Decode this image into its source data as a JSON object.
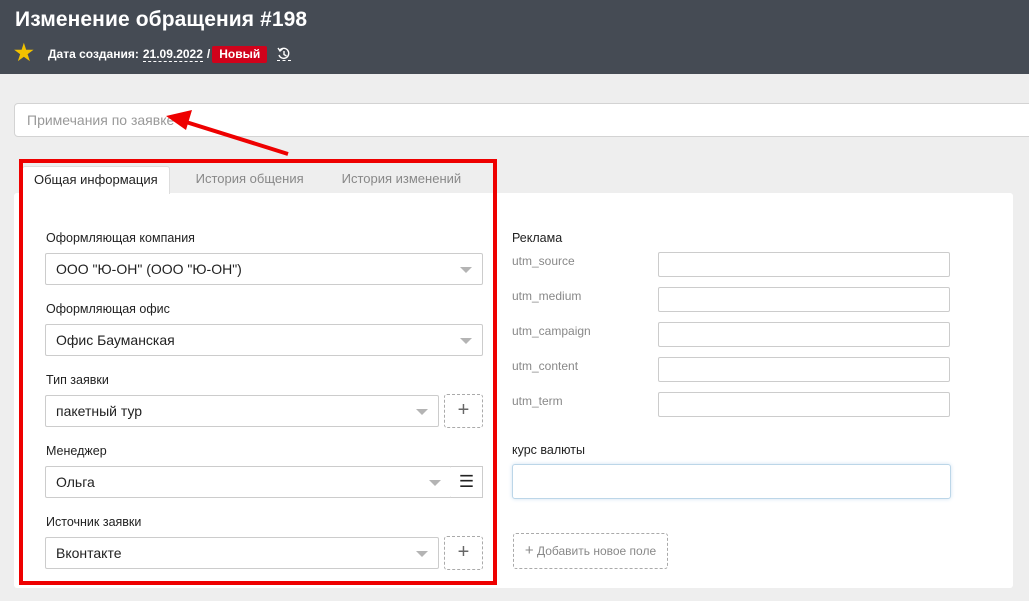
{
  "header": {
    "title": "Изменение обращения #198",
    "created_label": "Дата создания:",
    "created_date": "21.09.2022",
    "separator": "/",
    "status": "Новый"
  },
  "notes": {
    "placeholder": "Примечания по заявке"
  },
  "tabs": [
    {
      "label": "Общая информация"
    },
    {
      "label": "История общения"
    },
    {
      "label": "История изменений"
    }
  ],
  "form": {
    "company": {
      "label": "Оформляющая компания",
      "value": "ООО \"Ю-ОН\" (ООО \"Ю-ОН\")"
    },
    "office": {
      "label": "Оформляющая офис",
      "value": "Офис Бауманская"
    },
    "request_type": {
      "label": "Тип заявки",
      "value": "пакетный тур"
    },
    "manager": {
      "label": "Менеджер",
      "value": "Ольга"
    },
    "source": {
      "label": "Источник заявки",
      "value": "Вконтакте"
    }
  },
  "ads": {
    "label": "Реклама",
    "fields": [
      {
        "label": "utm_source",
        "value": ""
      },
      {
        "label": "utm_medium",
        "value": ""
      },
      {
        "label": "utm_campaign",
        "value": ""
      },
      {
        "label": "utm_content",
        "value": ""
      },
      {
        "label": "utm_term",
        "value": ""
      }
    ]
  },
  "currency": {
    "label": "курс валюты",
    "value": ""
  },
  "add_field": {
    "label": "Добавить новое поле"
  },
  "colors": {
    "header_bg": "#454b54",
    "status_bg": "#d0021b",
    "star": "#f2c200",
    "annotation": "#ee0000"
  },
  "icons": [
    "star-icon",
    "history-icon",
    "chevron-down-icon",
    "plus-icon",
    "list-icon",
    "arrow-annotation"
  ]
}
